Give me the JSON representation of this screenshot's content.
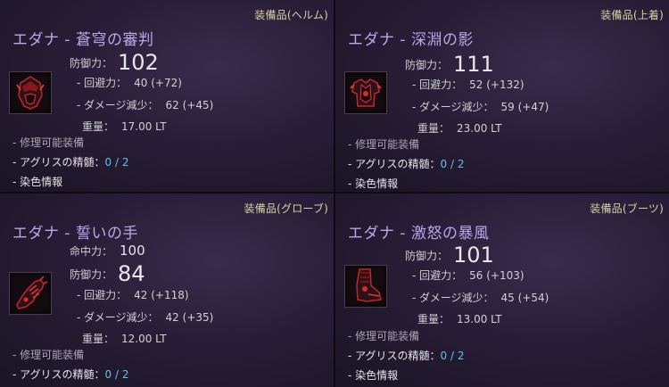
{
  "panels": [
    {
      "category": "装備品(ヘルム)",
      "title": "エダナ - 蒼穹の審判",
      "icon": "helmet-icon",
      "stats": {
        "defense_label": "防御力：",
        "defense": "102",
        "evasion_label": "- 回避力：",
        "evasion": "40 (+72)",
        "damage_reduction_label": "- ダメージ減少：",
        "damage_reduction": "62 (+45)",
        "weight_label": "重量：",
        "weight": "17.00 LT"
      },
      "notes": {
        "repairable": "- 修理可能装備",
        "agris_label": "- アグリスの精髄：",
        "agris_value": "0 / 2",
        "dye": "- 染色情報"
      }
    },
    {
      "category": "装備品(上着)",
      "title": "エダナ - 深淵の影",
      "icon": "armor-icon",
      "stats": {
        "defense_label": "防御力：",
        "defense": "111",
        "evasion_label": "- 回避力：",
        "evasion": "52 (+132)",
        "damage_reduction_label": "- ダメージ減少：",
        "damage_reduction": "59 (+47)",
        "weight_label": "重量：",
        "weight": "23.00 LT"
      },
      "notes": {
        "repairable": "- 修理可能装備",
        "agris_label": "- アグリスの精髄：",
        "agris_value": "0 / 2",
        "dye": "- 染色情報"
      }
    },
    {
      "category": "装備品(グローブ)",
      "title": "エダナ - 誓いの手",
      "icon": "gloves-icon",
      "stats": {
        "accuracy_label": "命中力：",
        "accuracy": "100",
        "defense_label": "防御力：",
        "defense": "84",
        "evasion_label": "- 回避力：",
        "evasion": "42 (+118)",
        "damage_reduction_label": "- ダメージ減少：",
        "damage_reduction": "42 (+35)",
        "weight_label": "重量：",
        "weight": "12.00 LT"
      },
      "notes": {
        "repairable": "- 修理可能装備",
        "agris_label": "- アグリスの精髄：",
        "agris_value": "0 / 2"
      }
    },
    {
      "category": "装備品(ブーツ)",
      "title": "エダナ - 激怒の暴風",
      "icon": "boots-icon",
      "stats": {
        "defense_label": "防御力：",
        "defense": "101",
        "evasion_label": "- 回避力：",
        "evasion": "56 (+103)",
        "damage_reduction_label": "- ダメージ減少：",
        "damage_reduction": "45 (+54)",
        "weight_label": "重量：",
        "weight": "13.00 LT"
      },
      "notes": {
        "repairable": "- 修理可能装備",
        "agris_label": "- アグリスの精髄：",
        "agris_value": "0 / 2",
        "dye": "- 染色情報"
      }
    }
  ],
  "colors": {
    "title": "#b9a7e8",
    "category": "#d7d1a5",
    "agris_value": "#5fc4e6"
  }
}
